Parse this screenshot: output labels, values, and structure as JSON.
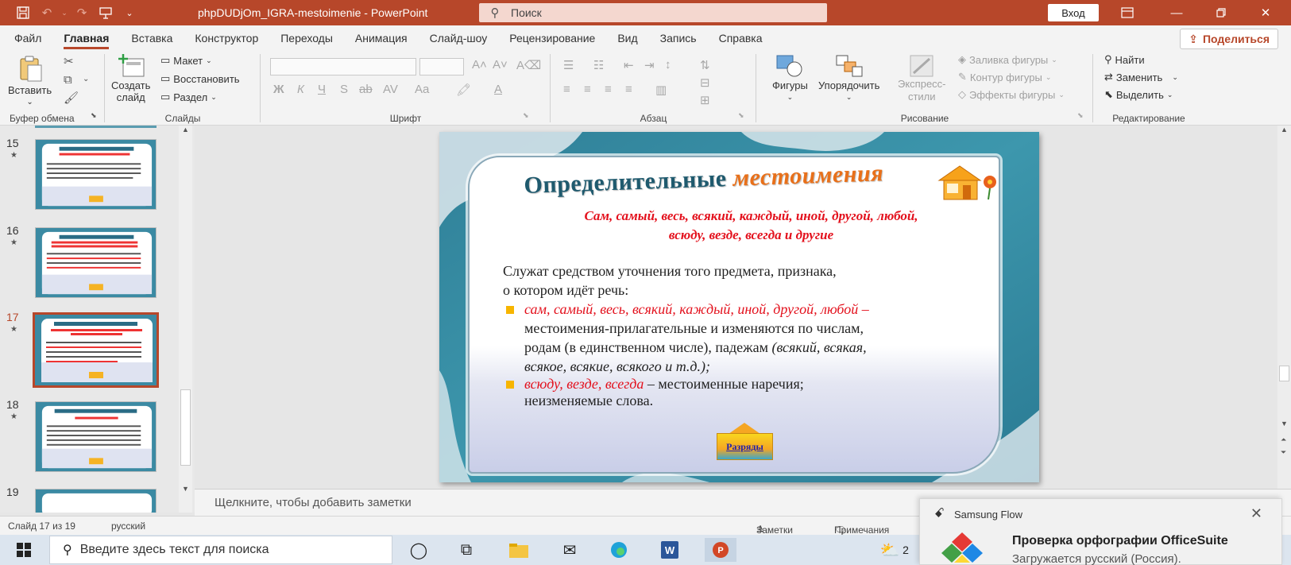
{
  "titlebar": {
    "doc_title": "phpDUDjOm_IGRA-mestoimenie  -  PowerPoint",
    "search_placeholder": "Поиск",
    "signin": "Вход",
    "accent": "#b7472a"
  },
  "menu": {
    "tabs": [
      "Файл",
      "Главная",
      "Вставка",
      "Конструктор",
      "Переходы",
      "Анимация",
      "Слайд-шоу",
      "Рецензирование",
      "Вид",
      "Запись",
      "Справка"
    ],
    "active_tab": "Главная",
    "share": "Поделиться"
  },
  "ribbon": {
    "clipboard": {
      "label": "Буфер обмена",
      "paste": "Вставить"
    },
    "slides": {
      "label": "Слайды",
      "new_slide_1": "Создать",
      "new_slide_2": "слайд",
      "layout": "Макет",
      "reset": "Восстановить",
      "section": "Раздел"
    },
    "font": {
      "label": "Шрифт"
    },
    "paragraph": {
      "label": "Абзац"
    },
    "drawing": {
      "label": "Рисование",
      "shapes": "Фигуры",
      "arrange": "Упорядочить",
      "quick_styles_1": "Экспресс-",
      "quick_styles_2": "стили",
      "shape_fill": "Заливка фигуры",
      "shape_outline": "Контур фигуры",
      "shape_effects": "Эффекты фигуры"
    },
    "editing": {
      "label": "Редактирование",
      "find": "Найти",
      "replace": "Заменить",
      "select": "Выделить"
    }
  },
  "thumbnails": [
    {
      "num": "15",
      "title": "Отрицательные местоимения"
    },
    {
      "num": "16",
      "title": "Указательные местоимения"
    },
    {
      "num": "17",
      "title": "Определительные местоимения"
    },
    {
      "num": "18",
      "title": "Притяжательные местоимения"
    },
    {
      "num": "19",
      "title": ""
    }
  ],
  "slide": {
    "title_plain": "Определительные",
    "title_em": "местоимения",
    "subtitle_line1": "Сам, самый, весь, всякий, каждый, иной, другой, любой,",
    "subtitle_line2": "всюду, везде, всегда и другие",
    "intro_line1": "Служат средством уточнения того предмета, признака,",
    "intro_line2": "о котором идёт речь:",
    "b1_red": "сам, самый, весь, всякий, каждый, иной, другой, любой –",
    "b1_line2": "местоимения-прилагательные и изменяются по числам,",
    "b1_line3_plain": "родам (в единственном числе), падежам ",
    "b1_line3_it": "(всякий, всякая,",
    "b1_line4_it": "всякое, всякие, всякого и т.д.);",
    "b2_red": "всюду, везде, всегда",
    "b2_plain": " – местоименные наречия;",
    "b2_line2": "неизменяемые слова.",
    "button": "Разряды"
  },
  "notes": {
    "placeholder": "Щелкните, чтобы добавить заметки"
  },
  "status": {
    "slide_counter": "Слайд 17 из 19",
    "language": "русский",
    "notes": "Заметки",
    "comments": "Примечания"
  },
  "taskbar": {
    "search_placeholder": "Введите здесь текст для поиска",
    "weather_num": "2"
  },
  "toast": {
    "app": "Samsung Flow",
    "heading": "Проверка орфографии OfficeSuite",
    "message": "Загружается русский (Россия)."
  }
}
